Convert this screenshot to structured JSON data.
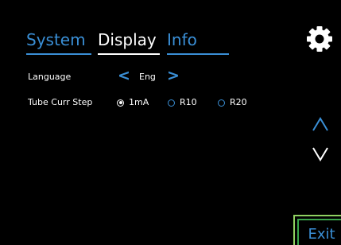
{
  "tabs": {
    "system": "System",
    "display": "Display",
    "info": "Info",
    "active": "Display"
  },
  "settings": {
    "language": {
      "label": "Language",
      "value": "Eng",
      "prev_glyph": "<",
      "next_glyph": ">"
    },
    "tube_curr_step": {
      "label": "Tube Curr Step",
      "options": [
        "1mA",
        "R10",
        "R20"
      ],
      "selected": "1mA"
    }
  },
  "controls": {
    "gear_icon": "gear-icon",
    "scroll_up_icon": "chevron-up-icon",
    "scroll_down_icon": "chevron-down-icon",
    "exit_label": "Exit"
  },
  "colors": {
    "background": "#000000",
    "accent": "#3a8fd6",
    "text": "#ffffff",
    "exit_border_outer": "#8fd061",
    "exit_border_inner": "#3aa54a"
  }
}
